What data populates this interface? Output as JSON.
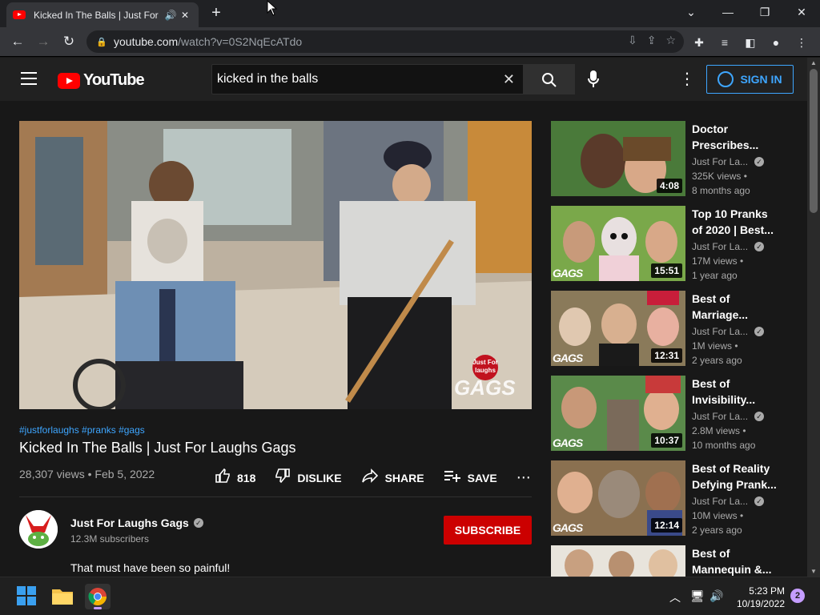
{
  "browser": {
    "tab_title": "Kicked In The Balls | Just For",
    "url_host": "youtube.com",
    "url_path": "/watch?v=0S2NqEcATdo",
    "new_tab": "+",
    "min": "—",
    "max": "❐",
    "close": "✕"
  },
  "youtube": {
    "logo_text": "YouTube",
    "search_value": "kicked in the balls",
    "sign_in": "SIGN IN",
    "brand_color": "#ff0000",
    "accent_color": "#3ea6ff"
  },
  "video": {
    "hashtags": "#justforlaughs #pranks #gags",
    "title": "Kicked In The Balls | Just For Laughs Gags",
    "meta": "28,307 views • Feb 5, 2022",
    "likes": "818",
    "dislike": "DISLIKE",
    "share": "SHARE",
    "save": "SAVE",
    "watermark_top": "Just For laughs",
    "watermark_bottom": "GAGS",
    "channel_name": "Just For Laughs Gags",
    "subscribers": "12.3M subscribers",
    "subscribe": "SUBSCRIBE",
    "description": "That must have been so painful!"
  },
  "recommendations": [
    {
      "title1": "Doctor",
      "title2": "Prescribes...",
      "channel": "Just For La...",
      "views": "325K views •",
      "age": "8 months ago",
      "duration": "4:08"
    },
    {
      "title1": "Top 10 Pranks",
      "title2": "of 2020 | Best...",
      "channel": "Just For La...",
      "views": "17M views •",
      "age": "1 year ago",
      "duration": "15:51"
    },
    {
      "title1": "Best of",
      "title2": "Marriage...",
      "channel": "Just For La...",
      "views": "1M views •",
      "age": "2 years ago",
      "duration": "12:31"
    },
    {
      "title1": "Best of",
      "title2": "Invisibility...",
      "channel": "Just For La...",
      "views": "2.8M views •",
      "age": "10 months ago",
      "duration": "10:37"
    },
    {
      "title1": "Best of Reality",
      "title2": "Defying Prank...",
      "channel": "Just For La...",
      "views": "10M views •",
      "age": "2 years ago",
      "duration": "12:14"
    },
    {
      "title1": "Best of",
      "title2": "Mannequin &...",
      "channel": "",
      "views": "",
      "age": "",
      "duration": ""
    }
  ],
  "gags_label": "GAGS",
  "taskbar": {
    "time": "5:23 PM",
    "date": "10/19/2022",
    "notifications": "2"
  }
}
